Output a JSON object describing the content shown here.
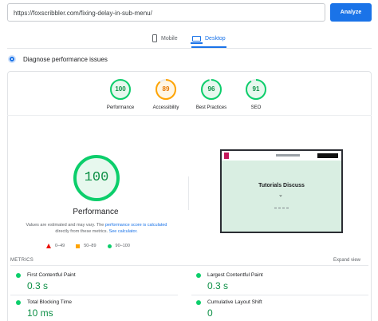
{
  "search": {
    "url": "https://foxscribbler.com/fixing-delay-in-sub-menu/",
    "analyze_label": "Analyze"
  },
  "tabs": {
    "mobile_label": "Mobile",
    "desktop_label": "Desktop",
    "selected": "Desktop"
  },
  "diagnose_label": "Diagnose performance issues",
  "scores": [
    {
      "label": "Performance",
      "value": "100",
      "score": 100,
      "color": "#0c8f45"
    },
    {
      "label": "Accessibility",
      "value": "89",
      "score": 89,
      "color": "#e67700"
    },
    {
      "label": "Best Practices",
      "value": "96",
      "score": 96,
      "color": "#0c8f45"
    },
    {
      "label": "SEO",
      "value": "91",
      "score": 91,
      "color": "#0c8f45"
    }
  ],
  "performance": {
    "score": "100",
    "title": "Performance",
    "note_prefix": "Values are estimated and may vary. The",
    "note_link1": "performance score is calculated",
    "note_mid": "directly from these metrics.",
    "note_link2": "See calculator."
  },
  "legend": {
    "poor": "0–49",
    "average": "50–89",
    "good": "90–100"
  },
  "screenshot": {
    "hero_text": "Tutorials Discuss",
    "chevron": "⌄"
  },
  "metrics": {
    "header": "METRICS",
    "expand_label": "Expand view",
    "items": [
      {
        "label": "First Contentful Paint",
        "value": "0.3 s"
      },
      {
        "label": "Largest Contentful Paint",
        "value": "0.3 s"
      },
      {
        "label": "Total Blocking Time",
        "value": "10 ms"
      },
      {
        "label": "Cumulative Layout Shift",
        "value": "0"
      }
    ]
  },
  "colors": {
    "accent": "#1a73e8",
    "pass": "#0cce6b",
    "average": "#ffa400",
    "fail": "#eb0f00"
  }
}
